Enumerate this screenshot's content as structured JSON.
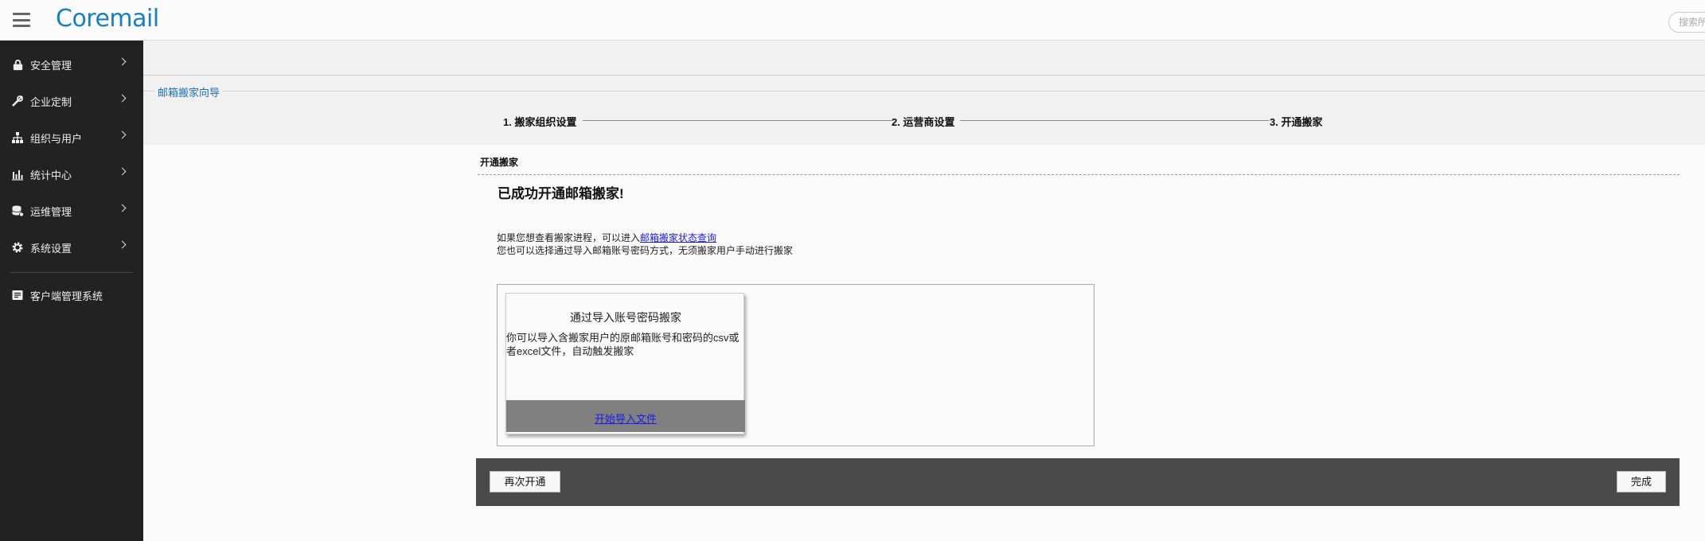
{
  "header": {
    "logo": "Coremail",
    "search_placeholder": "搜索所"
  },
  "sidebar": {
    "items": [
      {
        "label": "安全管理",
        "icon": "lock-icon"
      },
      {
        "label": "企业定制",
        "icon": "tools-icon"
      },
      {
        "label": "组织与用户",
        "icon": "org-chart-icon"
      },
      {
        "label": "统计中心",
        "icon": "bar-chart-icon"
      },
      {
        "label": "运维管理",
        "icon": "database-icon"
      },
      {
        "label": "系统设置",
        "icon": "gear-icon"
      }
    ],
    "extra": {
      "label": "客户端管理系统",
      "icon": "client-icon"
    }
  },
  "wizard": {
    "title": "邮箱搬家向导",
    "steps": [
      "1. 搬家组织设置",
      "2. 运营商设置",
      "3. 开通搬家"
    ]
  },
  "content": {
    "section_title": "开通搬家",
    "success": "已成功开通邮箱搬家!",
    "info_line1_prefix": "如果您想查看搬家进程，可以进入",
    "info_line1_link": "邮箱搬家状态查询",
    "info_line2": "您也可以选择通过导入邮箱账号密码方式，无须搬家用户手动进行搬家",
    "card": {
      "title": "通过导入账号密码搬家",
      "description": "你可以导入含搬家用户的原邮箱账号和密码的csv或者excel文件，自动触发搬家",
      "action": "开始导入文件"
    }
  },
  "actions": {
    "again": "再次开通",
    "done": "完成"
  }
}
